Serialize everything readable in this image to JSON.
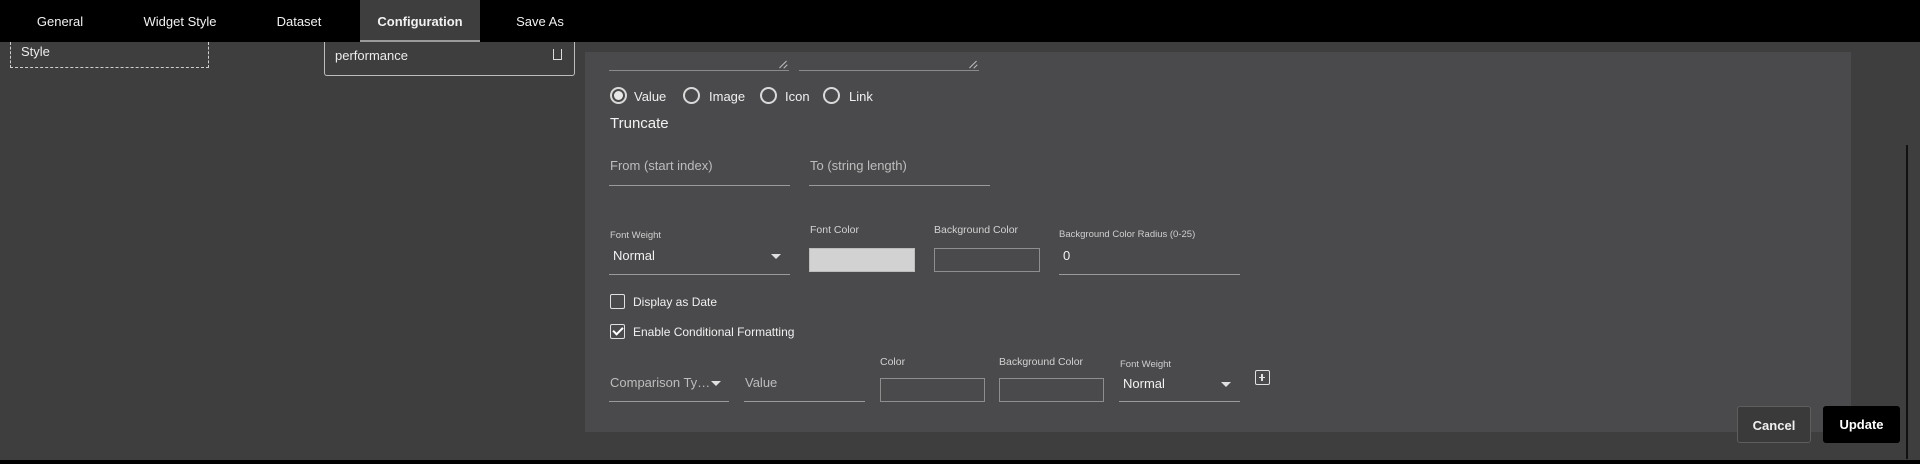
{
  "tabs": [
    {
      "label": "General"
    },
    {
      "label": "Widget Style"
    },
    {
      "label": "Dataset"
    },
    {
      "label": "Configuration",
      "active": true
    },
    {
      "label": "Save As"
    }
  ],
  "left": {
    "style_label": "Style",
    "performance_label": "performance"
  },
  "display_type": {
    "options": [
      "Value",
      "Image",
      "Icon",
      "Link"
    ],
    "selected": "Value"
  },
  "truncate": {
    "heading": "Truncate",
    "from_placeholder": "From (start index)",
    "to_placeholder": "To (string length)"
  },
  "style": {
    "font_weight_label": "Font Weight",
    "font_weight_value": "Normal",
    "font_color_label": "Font Color",
    "font_color_value": "#d2d2d2",
    "bg_color_label": "Background Color",
    "bg_radius_label": "Background Color Radius (0-25)",
    "bg_radius_value": "0"
  },
  "checkboxes": {
    "display_as_date": {
      "label": "Display as Date",
      "checked": false
    },
    "conditional_formatting": {
      "label": "Enable Conditional Formatting",
      "checked": true
    }
  },
  "conditional": {
    "comparison_type_placeholder": "Comparison Ty…",
    "value_placeholder": "Value",
    "color_label": "Color",
    "bg_color_label": "Background Color",
    "font_weight_label": "Font Weight",
    "font_weight_value": "Normal"
  },
  "actions": {
    "cancel": "Cancel",
    "update": "Update"
  },
  "icons": {
    "add": "plus-square-icon",
    "dropdown": "caret-down-icon"
  }
}
